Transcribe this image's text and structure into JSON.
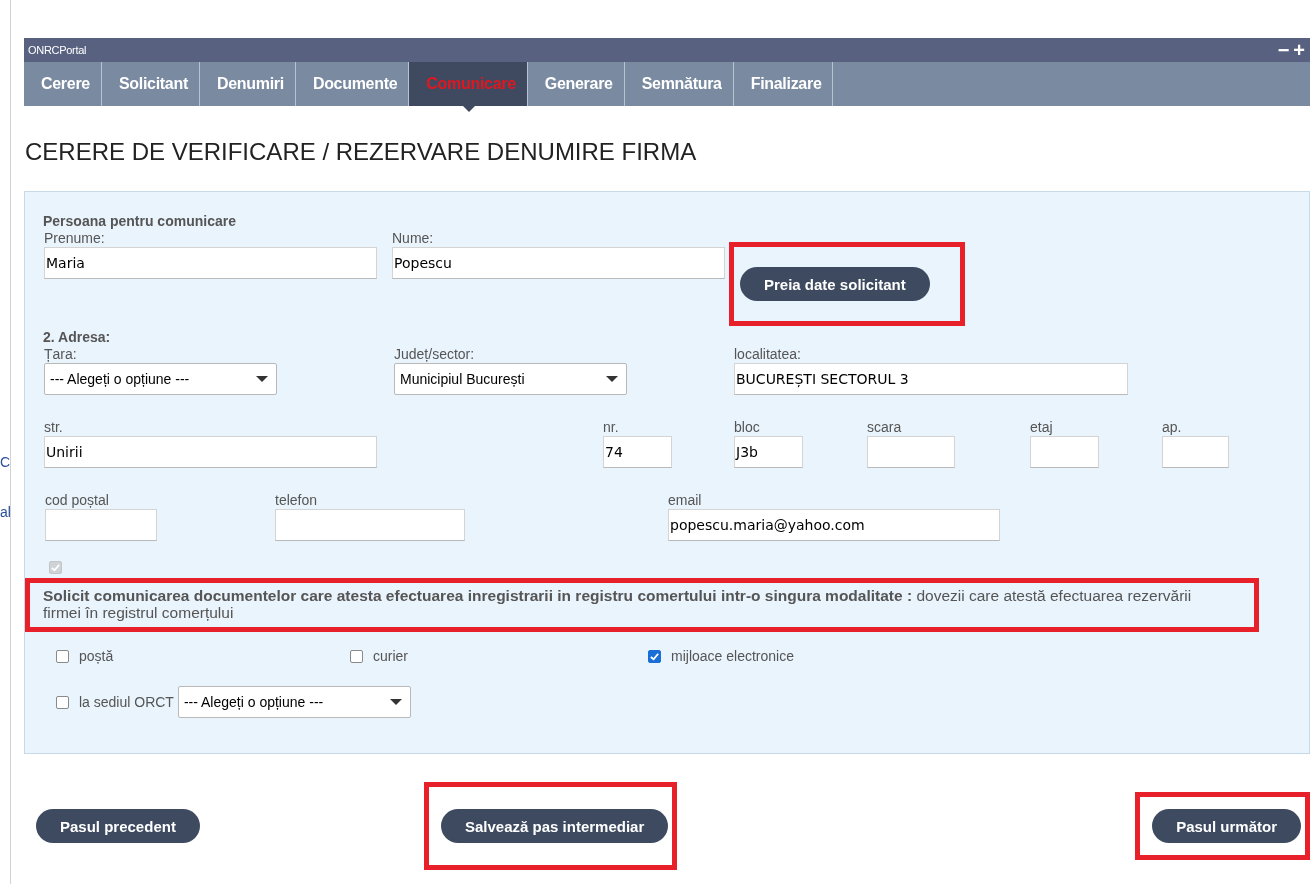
{
  "side_fragments": [
    "C",
    "al"
  ],
  "window": {
    "title": "ONRCPortal",
    "buttons": [
      "−",
      "+"
    ]
  },
  "tabs": [
    {
      "label": "Cerere",
      "selected": false
    },
    {
      "label": "Solicitant",
      "selected": false
    },
    {
      "label": "Denumiri",
      "selected": false
    },
    {
      "label": "Documente",
      "selected": false
    },
    {
      "label": "Comunicare",
      "selected": true
    },
    {
      "label": "Generare",
      "selected": false
    },
    {
      "label": "Semnătura",
      "selected": false
    },
    {
      "label": "Finalizare",
      "selected": false
    }
  ],
  "page_title": "CERERE DE VERIFICARE / REZERVARE DENUMIRE FIRMA",
  "contact": {
    "heading": "Persoana pentru comunicare",
    "fields": [
      {
        "kind": "input",
        "label": "Prenume:",
        "value": "Maria"
      },
      {
        "kind": "input",
        "label": "Nume:",
        "value": "Popescu"
      }
    ],
    "button": {
      "label": "Preia date solicitant",
      "highlighted": true
    }
  },
  "address": {
    "heading": "2. Adresa:",
    "rows": [
      [
        {
          "kind": "select",
          "label": "Țara:",
          "value": "--- Alegeți o opțiune ---"
        },
        {
          "kind": "select",
          "label": "Județ/sector:",
          "value": "Municipiul București"
        },
        {
          "kind": "input",
          "label": "localitatea:",
          "value": "BUCUREȘTI SECTORUL 3"
        }
      ],
      [
        {
          "kind": "input",
          "label": "str.",
          "value": "Unirii"
        },
        {
          "kind": "input",
          "label": "nr.",
          "value": "74"
        },
        {
          "kind": "input",
          "label": "bloc",
          "value": "J3b"
        },
        {
          "kind": "input",
          "label": "scara"
        },
        {
          "kind": "input",
          "label": "etaj"
        },
        {
          "kind": "input",
          "label": "ap."
        }
      ],
      [
        {
          "kind": "input",
          "label": "cod poștal"
        },
        {
          "kind": "input",
          "label": "telefon"
        },
        {
          "kind": "input",
          "label": "email",
          "value": "popescu.maria@yahoo.com"
        }
      ]
    ]
  },
  "single_mode": {
    "checked": true,
    "disabled": true,
    "notice": "**Solicit comunicarea documentelor care atesta efectuarea inregistrarii in registru comertului intr-o singura modalitate :** dovezii care atestă efectuarea rezervării firmei în registrul comerțului",
    "highlighted": true
  },
  "delivery_options": [
    {
      "kind": "checkbox",
      "label": "poștă",
      "checked": false
    },
    {
      "kind": "checkbox",
      "label": "curier",
      "checked": false
    },
    {
      "kind": "checkbox",
      "label": "mijloace electronice",
      "checked": true
    },
    {
      "kind": "checkbox_select",
      "label": "la sediul ORCT",
      "checked": false,
      "select": "--- Alegeți o opțiune ---"
    }
  ],
  "footer_buttons": [
    {
      "label": "Pasul precedent",
      "highlighted": false
    },
    {
      "label": "Salvează pas intermediar",
      "highlighted": true
    },
    {
      "label": "Pasul următor",
      "highlighted": true
    }
  ]
}
